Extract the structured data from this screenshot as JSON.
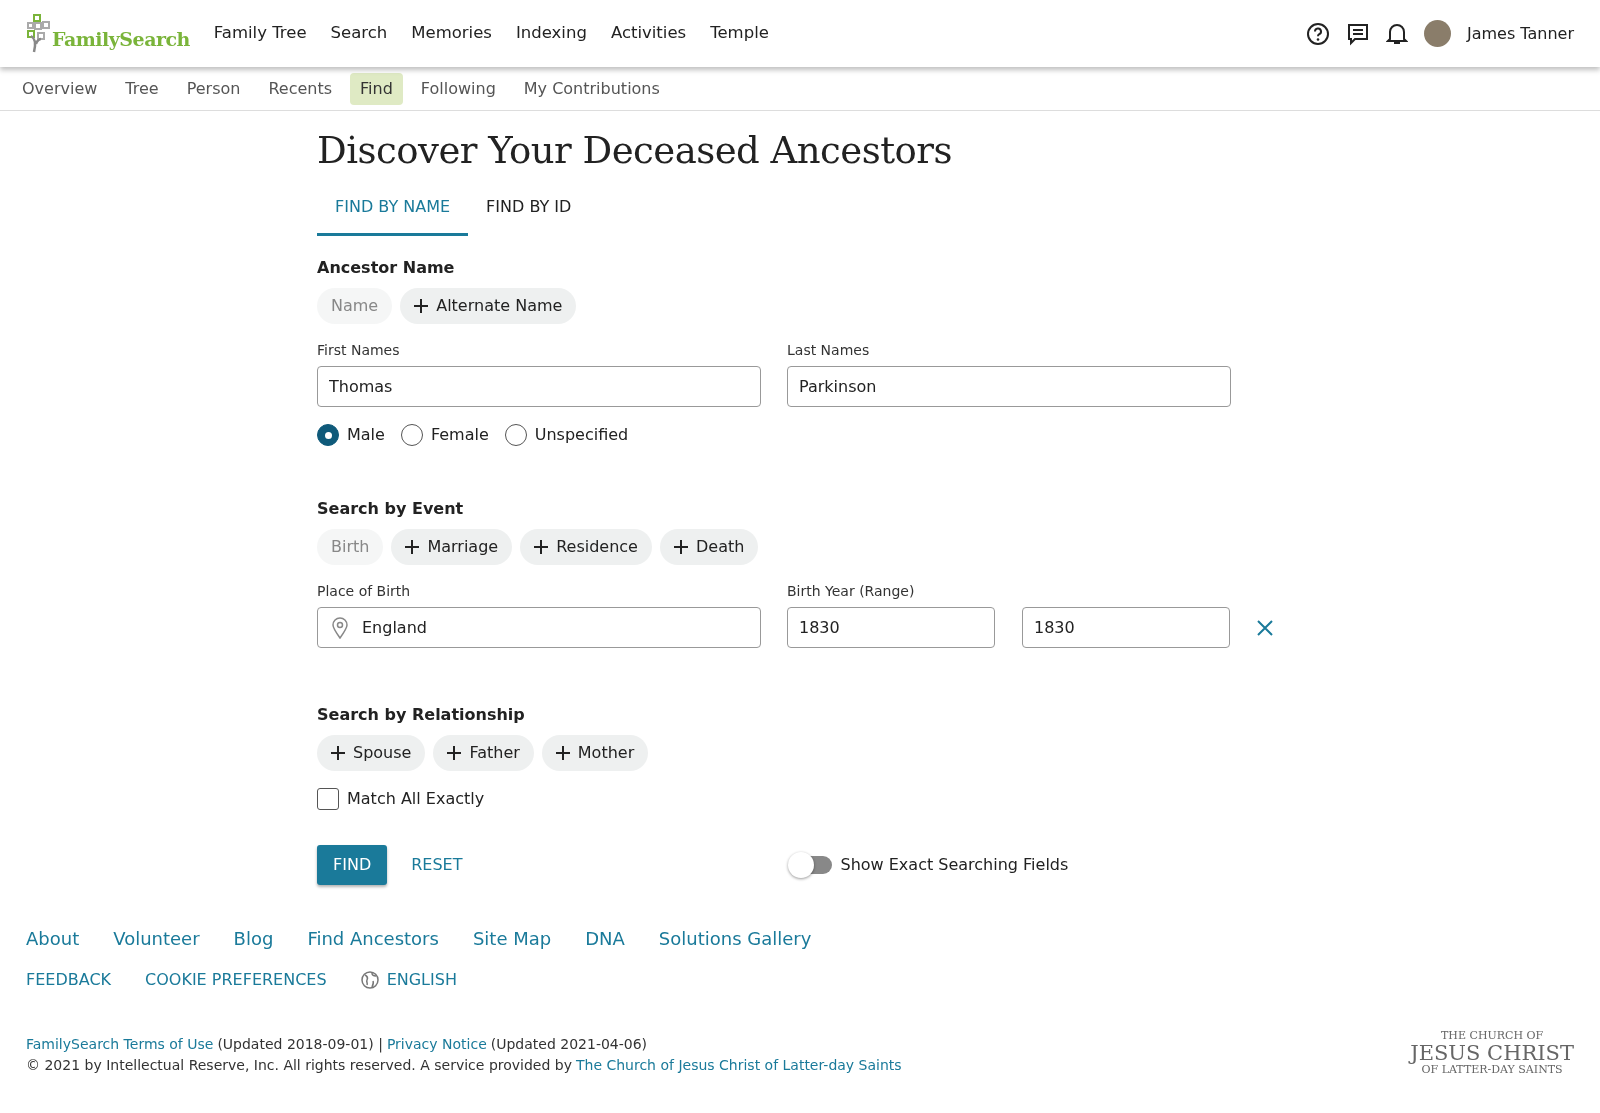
{
  "header": {
    "logo": "FamilySearch",
    "nav": [
      "Family Tree",
      "Search",
      "Memories",
      "Indexing",
      "Activities",
      "Temple"
    ],
    "user": "James Tanner"
  },
  "subnav": [
    {
      "label": "Overview",
      "selected": false
    },
    {
      "label": "Tree",
      "selected": false
    },
    {
      "label": "Person",
      "selected": false
    },
    {
      "label": "Recents",
      "selected": false
    },
    {
      "label": "Find",
      "selected": true
    },
    {
      "label": "Following",
      "selected": false
    },
    {
      "label": "My Contributions",
      "selected": false
    }
  ],
  "title": "Discover Your Deceased Ancestors",
  "tabs": [
    {
      "label": "FIND BY NAME",
      "selected": true
    },
    {
      "label": "FIND BY ID",
      "selected": false
    }
  ],
  "ancestor_name": {
    "heading": "Ancestor Name",
    "chips": [
      {
        "label": "Name",
        "added": true
      },
      {
        "label": "Alternate Name",
        "added": false
      }
    ],
    "fields": [
      {
        "label": "First Names",
        "value": "Thomas"
      },
      {
        "label": "Last Names",
        "value": "Parkinson"
      }
    ],
    "sex": [
      {
        "label": "Male",
        "selected": true
      },
      {
        "label": "Female",
        "selected": false
      },
      {
        "label": "Unspecified",
        "selected": false
      }
    ]
  },
  "event": {
    "heading": "Search by Event",
    "chips": [
      {
        "label": "Birth",
        "added": true
      },
      {
        "label": "Marriage",
        "added": false
      },
      {
        "label": "Residence",
        "added": false
      },
      {
        "label": "Death",
        "added": false
      }
    ],
    "place": {
      "label": "Place of Birth",
      "value": "England"
    },
    "year": {
      "label": "Birth Year (Range)",
      "from": "1830",
      "to": "1830"
    }
  },
  "relationship": {
    "heading": "Search by Relationship",
    "chips": [
      {
        "label": "Spouse",
        "added": false
      },
      {
        "label": "Father",
        "added": false
      },
      {
        "label": "Mother",
        "added": false
      }
    ]
  },
  "match_all": {
    "label": "Match All Exactly",
    "checked": false
  },
  "buttons": {
    "find": "FIND",
    "reset": "RESET"
  },
  "exact_toggle": {
    "label": "Show Exact Searching Fields",
    "on": false
  },
  "footer": {
    "links": [
      "About",
      "Volunteer",
      "Blog",
      "Find Ancestors",
      "Site Map",
      "DNA",
      "Solutions Gallery"
    ],
    "secondary": [
      "FEEDBACK",
      "COOKIE PREFERENCES"
    ],
    "language": "ENGLISH",
    "terms_link": "FamilySearch Terms of Use",
    "terms_updated": "(Updated 2018-09-01) |",
    "privacy_link": "Privacy Notice",
    "privacy_updated": "(Updated 2021-04-06)",
    "copyright": "© 2021 by Intellectual Reserve, Inc. All rights reserved. A service provided by",
    "church_link": "The Church of Jesus Christ of Latter-day Saints",
    "church_logo": [
      "THE CHURCH OF",
      "JESUS CHRIST",
      "OF LATTER-DAY SAINTS"
    ]
  }
}
